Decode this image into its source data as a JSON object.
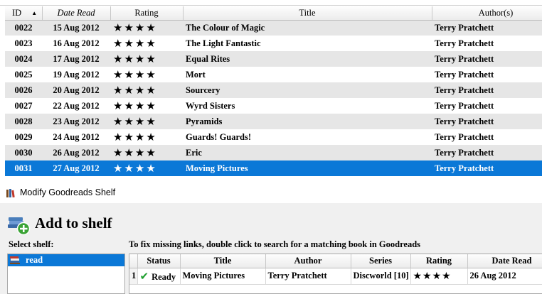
{
  "books": {
    "columns": {
      "id": "ID",
      "date": "Date Read",
      "rating": "Rating",
      "title": "Title",
      "author": "Author(s)"
    },
    "rows": [
      {
        "id": "0022",
        "date": "15 Aug 2012",
        "rating": "★★★★",
        "title": "The Colour of Magic",
        "author": "Terry Pratchett"
      },
      {
        "id": "0023",
        "date": "16 Aug 2012",
        "rating": "★★★★",
        "title": "The Light Fantastic",
        "author": "Terry Pratchett"
      },
      {
        "id": "0024",
        "date": "17 Aug 2012",
        "rating": "★★★★",
        "title": "Equal Rites",
        "author": "Terry Pratchett"
      },
      {
        "id": "0025",
        "date": "19 Aug 2012",
        "rating": "★★★★",
        "title": "Mort",
        "author": "Terry Pratchett"
      },
      {
        "id": "0026",
        "date": "20 Aug 2012",
        "rating": "★★★★",
        "title": "Sourcery",
        "author": "Terry Pratchett"
      },
      {
        "id": "0027",
        "date": "22 Aug 2012",
        "rating": "★★★★",
        "title": "Wyrd Sisters",
        "author": "Terry Pratchett"
      },
      {
        "id": "0028",
        "date": "23 Aug 2012",
        "rating": "★★★★",
        "title": "Pyramids",
        "author": "Terry Pratchett"
      },
      {
        "id": "0029",
        "date": "24 Aug 2012",
        "rating": "★★★★",
        "title": "Guards! Guards!",
        "author": "Terry Pratchett"
      },
      {
        "id": "0030",
        "date": "26 Aug 2012",
        "rating": "★★★★",
        "title": "Eric",
        "author": "Terry Pratchett"
      },
      {
        "id": "0031",
        "date": "27 Aug 2012",
        "rating": "★★★★",
        "title": "Moving Pictures",
        "author": "Terry Pratchett"
      }
    ],
    "selected_index": 9
  },
  "dialog": {
    "title": "Modify Goodreads Shelf",
    "heading": "Add to shelf",
    "select_shelf_label": "Select shelf:",
    "hint": "To fix missing links, double click to search for a matching book in Goodreads",
    "shelves": [
      "read"
    ],
    "results": {
      "columns": {
        "status": "Status",
        "title": "Title",
        "author": "Author",
        "series": "Series",
        "rating": "Rating",
        "date": "Date Read"
      },
      "rows": [
        {
          "num": "1",
          "status": "Ready",
          "title": "Moving Pictures",
          "author": "Terry Pratchett",
          "series": "Discworld [10]",
          "rating": "★★★★",
          "date": "26 Aug 2012"
        }
      ]
    }
  },
  "icons": {
    "sort": "sort-ascending-icon",
    "check": "checkmark-icon",
    "books": "books-icon",
    "add_shelf": "add-to-shelf-icon",
    "shelf": "shelf-icon"
  },
  "colors": {
    "selection": "#0b78d7",
    "check": "#1e9e2e",
    "alt_row": "#e6e6e6"
  }
}
